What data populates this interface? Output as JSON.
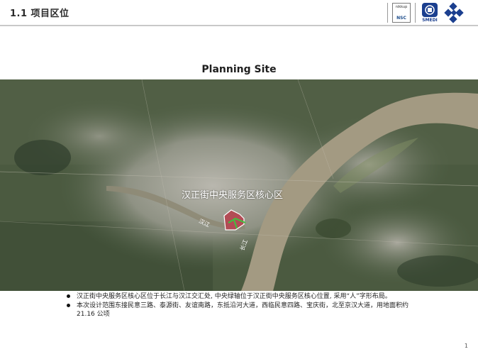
{
  "header": {
    "section_title": "1.1 项目区位",
    "logos": [
      {
        "name": "nsc-logo",
        "top_text": "nikkup",
        "bottom_text": "NSC"
      },
      {
        "name": "smedi-logo",
        "text": "SMEDI"
      },
      {
        "name": "diamond-logo"
      }
    ]
  },
  "page_heading": "Planning Site",
  "map": {
    "caption": "汉正街中央服务区核心区",
    "labels": {
      "hanjiang": "汉江",
      "changjiang": "长江"
    },
    "colors": {
      "site_fill": "#b24c55",
      "green_axis": "#3ec43e",
      "river": "#a39a82",
      "boundary": "#ffffff"
    }
  },
  "bullets": [
    "汉正街中央服务区核心区位于长江与汉江交汇处, 中央绿轴位于汉正街中央服务区核心位置, 采用“人”字形布局。",
    "本次设计范围东接民意三路、泰源街、友谊南路，东抵沿河大道，西临民意四路、宝庆街，北至京汉大道，用地面积约 21.16 公顷"
  ],
  "page_number": "1"
}
